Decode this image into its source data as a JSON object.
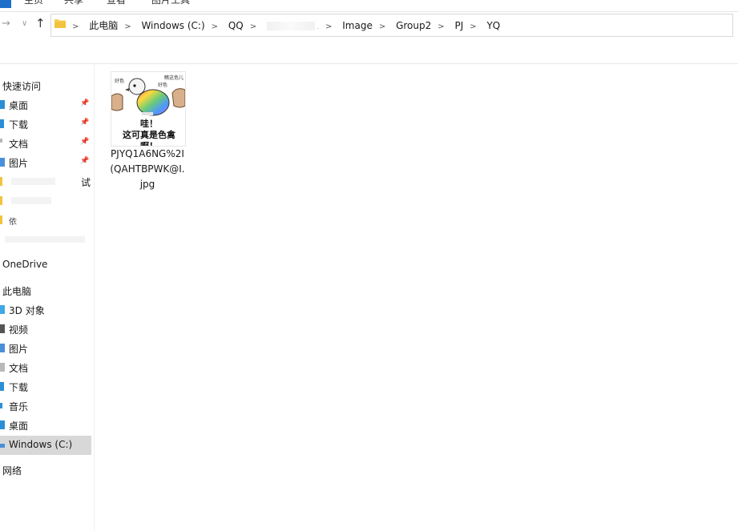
{
  "ribbon": {
    "tabs": [
      "主页",
      "共享",
      "查看",
      "图片工具"
    ]
  },
  "address": {
    "breadcrumbs": [
      "此电脑",
      "Windows (C:)",
      "QQ",
      "",
      "Image",
      "Group2",
      "PJ",
      "YQ"
    ]
  },
  "sidebar": {
    "quick_access": "快速访问",
    "pinned": [
      {
        "label": "桌面",
        "icon": "desktop-icon",
        "color": "#2b8fd6"
      },
      {
        "label": "下载",
        "icon": "download-icon",
        "color": "#2b8fd6"
      },
      {
        "label": "文档",
        "icon": "document-icon",
        "color": "#7a7a7a"
      },
      {
        "label": "图片",
        "icon": "picture-icon",
        "color": "#4a90d9"
      }
    ],
    "partial_items": [
      "试",
      "依"
    ],
    "onedrive": "OneDrive",
    "this_pc": "此电脑",
    "pc_items": [
      {
        "label": "3D 对象",
        "icon": "3d-objects-icon",
        "color": "#3fa9e6"
      },
      {
        "label": "视频",
        "icon": "video-icon",
        "color": "#555555"
      },
      {
        "label": "图片",
        "icon": "picture-icon",
        "color": "#4a90d9"
      },
      {
        "label": "文档",
        "icon": "document-icon",
        "color": "#7a7a7a"
      },
      {
        "label": "下载",
        "icon": "download-icon",
        "color": "#2b8fd6"
      },
      {
        "label": "音乐",
        "icon": "music-icon",
        "color": "#2b8fd6"
      },
      {
        "label": "桌面",
        "icon": "desktop-icon",
        "color": "#2b8fd6"
      },
      {
        "label": "Windows (C:)",
        "icon": "drive-icon",
        "color": "#4a90d9"
      }
    ],
    "network": "网络"
  },
  "files": [
    {
      "caption_lines": [
        "PJYQ1A6NG%2I",
        "(QAHTBPWK@I.",
        "jpg"
      ],
      "thumb_text": [
        "哇！",
        "这可真是色禽啊！"
      ],
      "thumb_small": [
        "好色",
        "瞧这色儿",
        "好色"
      ]
    }
  ],
  "colors": {
    "accent": "#1e6fc8",
    "selected": "#d8d8d8"
  }
}
